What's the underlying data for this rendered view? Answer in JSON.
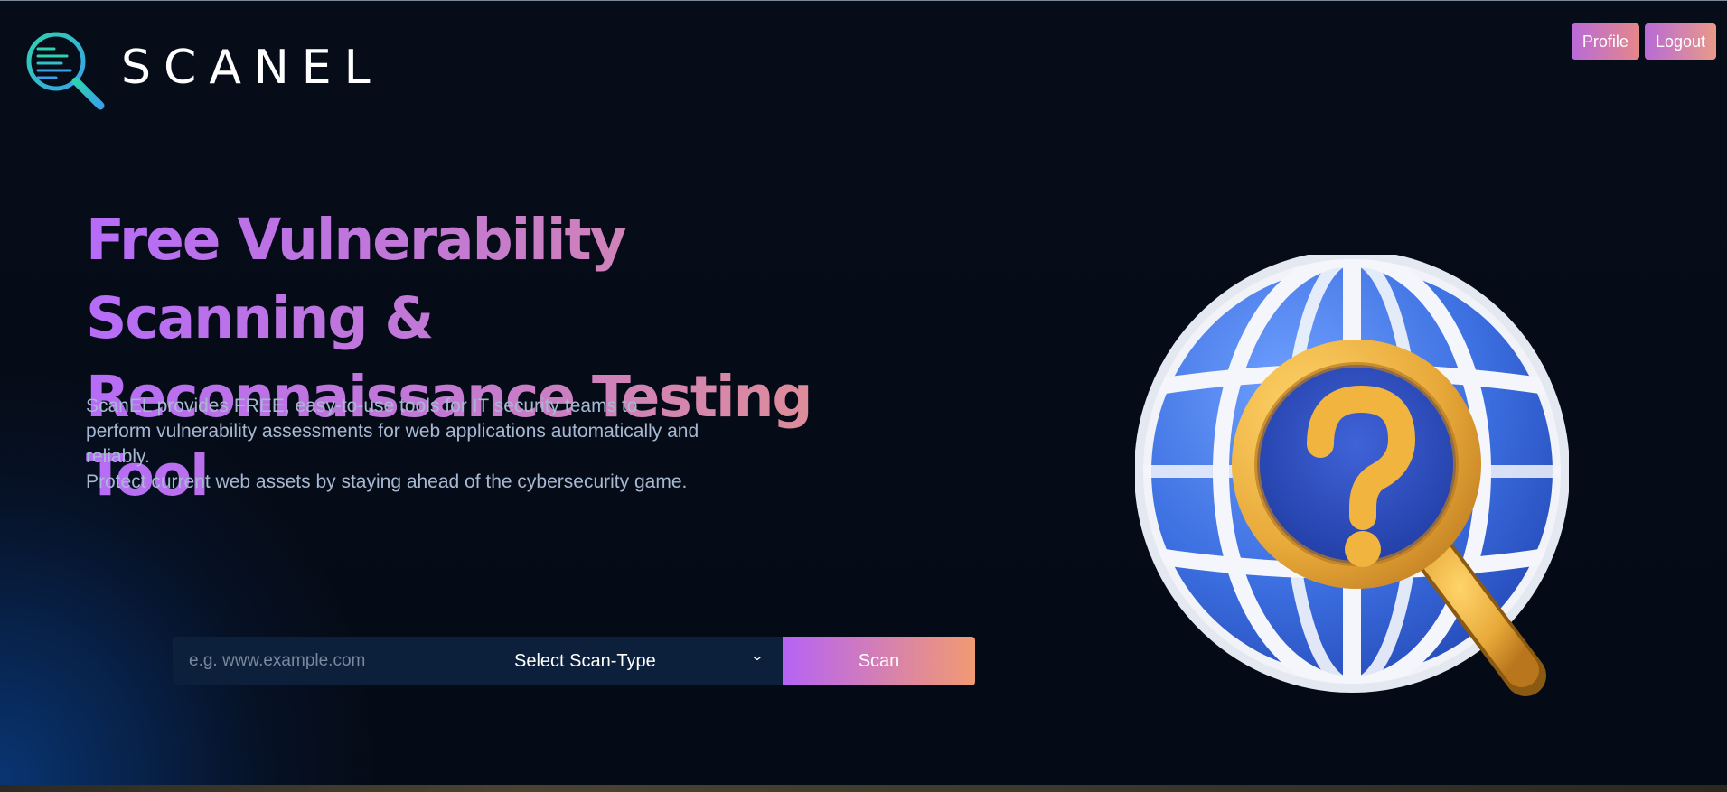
{
  "brand": {
    "name": "SCANEL"
  },
  "nav": {
    "profile_label": "Profile",
    "logout_label": "Logout"
  },
  "hero": {
    "headline_line1": "Free Vulnerability Scanning &",
    "headline_line2": "Reconnaissance Testing Tool",
    "description_p1": "ScanEL provides FREE, easy-to-use tools for IT security teams to perform vulnerability assessments for web applications automatically and reliably.",
    "description_p2": "Protect current web assets by staying ahead of the cybersecurity game."
  },
  "scan_form": {
    "url_placeholder": "e.g. www.example.com",
    "scan_type_selected": "Select Scan-Type",
    "scan_button_label": "Scan"
  },
  "icons": {
    "logo": "magnifier-logo-icon",
    "dropdown": "chevron-down-icon",
    "illustration": "globe-magnifier-question-icon"
  },
  "colors": {
    "background": "#050b16",
    "accent_start": "#b563f6",
    "accent_end": "#f29a72",
    "input_bg": "#0c1f3b",
    "logo_teal": "#2fd3b0",
    "logo_blue": "#3aa0e8"
  }
}
